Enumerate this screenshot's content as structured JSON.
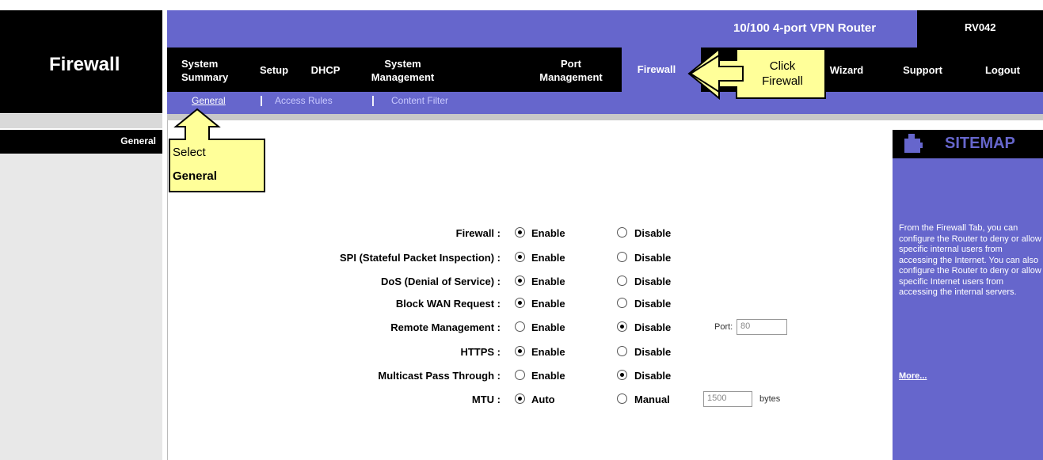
{
  "page": {
    "title": "Firewall",
    "section": "General"
  },
  "header": {
    "product": "10/100 4-port VPN Router",
    "model": "RV042"
  },
  "nav": {
    "items": [
      {
        "label": "System\nSummary"
      },
      {
        "label": "Setup"
      },
      {
        "label": "DHCP"
      },
      {
        "label": "System\nManagement"
      },
      {
        "label": "Port\nManagement"
      },
      {
        "label": "Firewall"
      },
      {
        "label": "Wizard"
      },
      {
        "label": "Support"
      },
      {
        "label": "Logout"
      }
    ]
  },
  "subnav": {
    "items": [
      {
        "label": "General"
      },
      {
        "label": "Access Rules"
      },
      {
        "label": "Content Filter"
      }
    ],
    "separator": "|"
  },
  "form": {
    "rows": [
      {
        "label": "Firewall :",
        "opt1": "Enable",
        "opt2": "Disable",
        "selected": 1
      },
      {
        "label": "SPI (Stateful Packet Inspection) :",
        "opt1": "Enable",
        "opt2": "Disable",
        "selected": 1
      },
      {
        "label": "DoS (Denial of Service) :",
        "opt1": "Enable",
        "opt2": "Disable",
        "selected": 1
      },
      {
        "label": "Block WAN Request :",
        "opt1": "Enable",
        "opt2": "Disable",
        "selected": 1
      },
      {
        "label": "Remote Management :",
        "opt1": "Enable",
        "opt2": "Disable",
        "selected": 2
      },
      {
        "label": "HTTPS :",
        "opt1": "Enable",
        "opt2": "Disable",
        "selected": 1
      },
      {
        "label": "Multicast Pass Through :",
        "opt1": "Enable",
        "opt2": "Disable",
        "selected": 2
      },
      {
        "label": "MTU :",
        "opt1": "Auto",
        "opt2": "Manual",
        "selected": 1
      }
    ],
    "port_label": "Port:",
    "port_value": "80",
    "mtu_value": "1500",
    "mtu_unit": "bytes"
  },
  "sitemap": {
    "title": "SITEMAP",
    "text": "From the Firewall Tab, you can configure the Router to deny or allow specific internal users from accessing the Internet. You can also configure the Router to deny or allow specific Internet users from accessing the internal servers.",
    "more": "More..."
  },
  "callouts": {
    "click": "Click\nFirewall",
    "select_line1": "Select",
    "select_line2": "General"
  },
  "colors": {
    "purple": "#6666cc",
    "black": "#000000",
    "callout": "#ffff99"
  }
}
